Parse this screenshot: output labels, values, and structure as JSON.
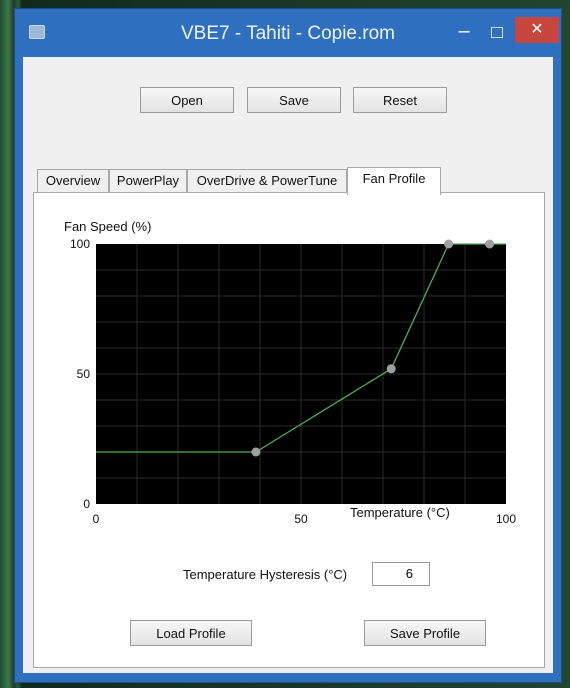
{
  "window": {
    "title": "VBE7 - Tahiti - Copie.rom"
  },
  "toolbar": {
    "open": "Open",
    "save": "Save",
    "reset": "Reset"
  },
  "tabs": [
    "Overview",
    "PowerPlay",
    "OverDrive & PowerTune",
    "Fan Profile"
  ],
  "active_tab": "Fan Profile",
  "fan_profile": {
    "hysteresis_label": "Temperature Hysteresis (°C)",
    "hysteresis_value": "6",
    "load_label": "Load Profile",
    "save_label": "Save Profile"
  },
  "chart_data": {
    "type": "line",
    "title": "",
    "ylabel": "Fan Speed (%)",
    "xlabel": "Temperature (°C)",
    "xlim": [
      0,
      100
    ],
    "ylim": [
      0,
      100
    ],
    "x_ticks": [
      "0",
      "50",
      "100"
    ],
    "y_ticks": [
      "100",
      "50",
      "0"
    ],
    "grid": true,
    "background": "#000000",
    "line_color": "#4caf50",
    "point_color": "#a0a0a0",
    "series": [
      {
        "x": [
          0,
          39,
          72,
          86,
          96,
          100
        ],
        "y": [
          20,
          20,
          52,
          100,
          100,
          100
        ]
      }
    ],
    "control_points": [
      {
        "x": 39,
        "y": 20
      },
      {
        "x": 72,
        "y": 52
      },
      {
        "x": 86,
        "y": 100
      },
      {
        "x": 96,
        "y": 100
      }
    ]
  }
}
